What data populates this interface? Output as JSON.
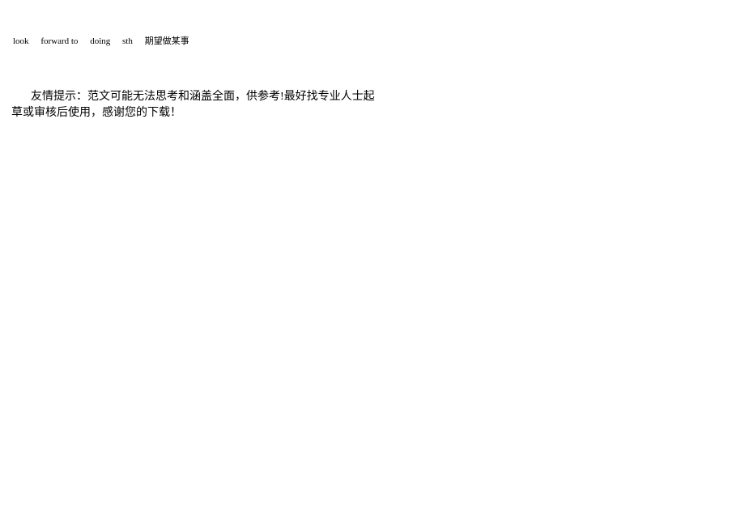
{
  "line1": {
    "w1": "look",
    "w2": "forward to",
    "w3": "doing",
    "w4": "sth",
    "w5": "期望做某事"
  },
  "notice": {
    "text": "友情提示：范文可能无法思考和涵盖全面，供参考!最好找专业人士起草或审核后使用，感谢您的下载！"
  }
}
